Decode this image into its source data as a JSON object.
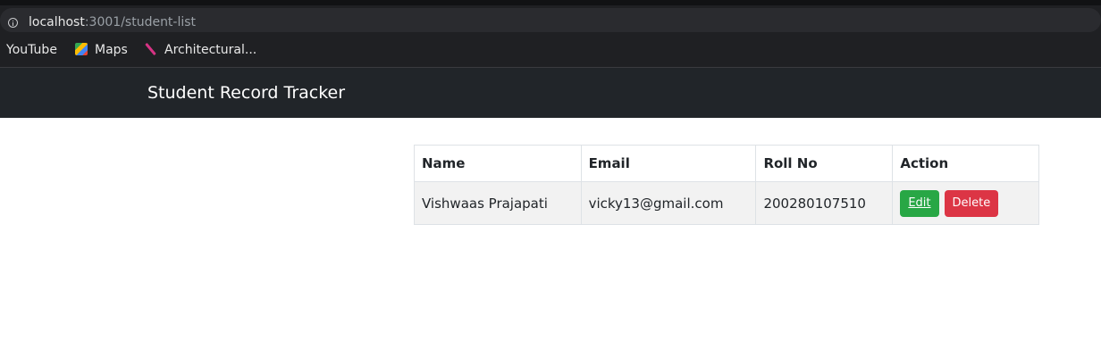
{
  "browser": {
    "url_host": "localhost",
    "url_path": ":3001/student-list",
    "bookmarks": [
      {
        "label": "YouTube",
        "icon": "none"
      },
      {
        "label": "Maps",
        "icon": "maps-icon"
      },
      {
        "label": "Architectural...",
        "icon": "architecture-icon"
      }
    ]
  },
  "navbar": {
    "brand": "Student Record Tracker"
  },
  "table": {
    "headers": [
      "Name",
      "Email",
      "Roll No",
      "Action"
    ],
    "rows": [
      {
        "name": "Vishwaas Prajapati",
        "email": "vicky13@gmail.com",
        "roll_no": "200280107510",
        "edit_label": "Edit",
        "delete_label": "Delete"
      }
    ]
  },
  "colors": {
    "navbar_bg": "#212529",
    "edit_button": "#28a745",
    "delete_button": "#dc3545"
  }
}
